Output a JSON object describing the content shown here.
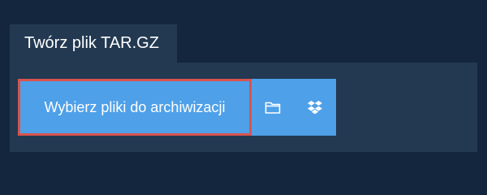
{
  "tab": {
    "title": "Twórz plik TAR.GZ"
  },
  "upload": {
    "choose_label": "Wybierz pliki do archiwizacji",
    "icons": [
      "folder-icon",
      "dropbox-icon"
    ]
  },
  "colors": {
    "page_background": "#14263d",
    "panel_background": "#233952",
    "button_background": "#4ea0e8",
    "button_focus_border": "#d9534f",
    "text": "#ffffff"
  }
}
